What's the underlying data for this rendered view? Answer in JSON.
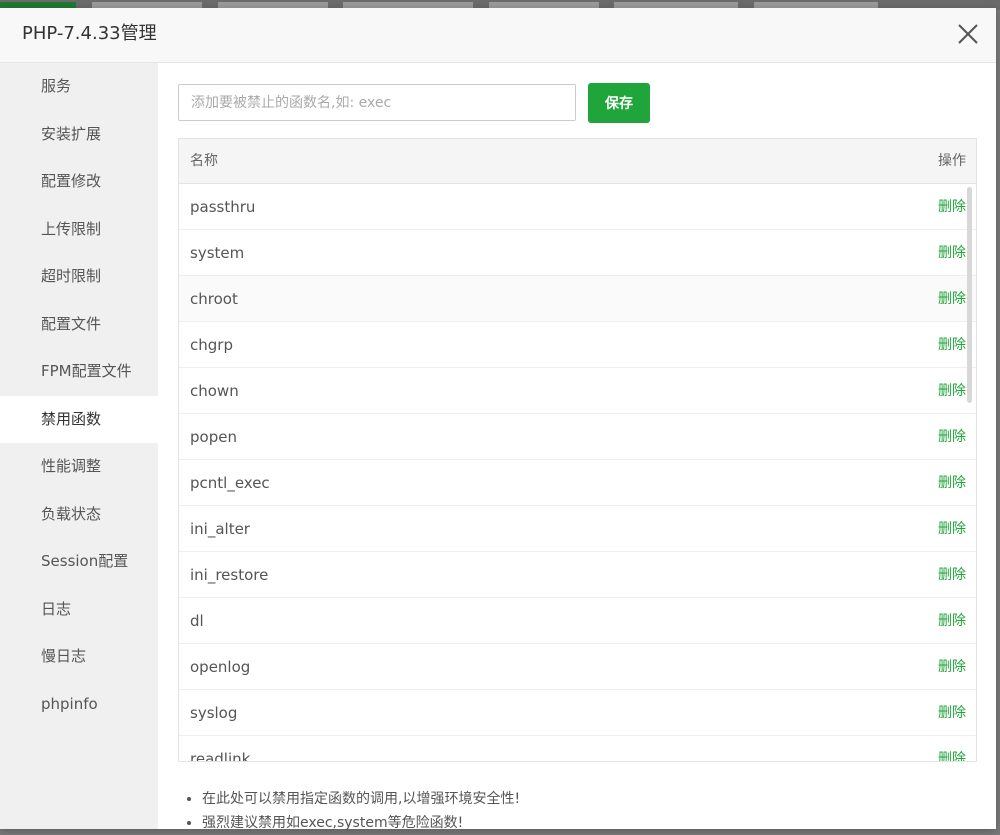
{
  "dialog": {
    "title": "PHP-7.4.33管理"
  },
  "sidebar": {
    "items": [
      {
        "label": "服务"
      },
      {
        "label": "安装扩展"
      },
      {
        "label": "配置修改"
      },
      {
        "label": "上传限制"
      },
      {
        "label": "超时限制"
      },
      {
        "label": "配置文件"
      },
      {
        "label": "FPM配置文件"
      },
      {
        "label": "禁用函数"
      },
      {
        "label": "性能调整"
      },
      {
        "label": "负载状态"
      },
      {
        "label": "Session配置"
      },
      {
        "label": "日志"
      },
      {
        "label": "慢日志"
      },
      {
        "label": "phpinfo"
      }
    ],
    "active_index": 7
  },
  "form": {
    "input_placeholder": "添加要被禁止的函数名,如: exec",
    "input_value": "",
    "save_label": "保存"
  },
  "table": {
    "headers": {
      "name": "名称",
      "action": "操作"
    },
    "delete_label": "删除",
    "rows": [
      {
        "name": "passthru"
      },
      {
        "name": "system"
      },
      {
        "name": "chroot"
      },
      {
        "name": "chgrp"
      },
      {
        "name": "chown"
      },
      {
        "name": "popen"
      },
      {
        "name": "pcntl_exec"
      },
      {
        "name": "ini_alter"
      },
      {
        "name": "ini_restore"
      },
      {
        "name": "dl"
      },
      {
        "name": "openlog"
      },
      {
        "name": "syslog"
      },
      {
        "name": "readlink"
      }
    ]
  },
  "tips": [
    "在此处可以禁用指定函数的调用,以增强环境安全性!",
    "强烈建议禁用如exec,system等危险函数!"
  ],
  "colors": {
    "accent": "#20a53a",
    "sidebar_bg": "#f0f0f0",
    "header_bg": "#f5f5f5"
  }
}
